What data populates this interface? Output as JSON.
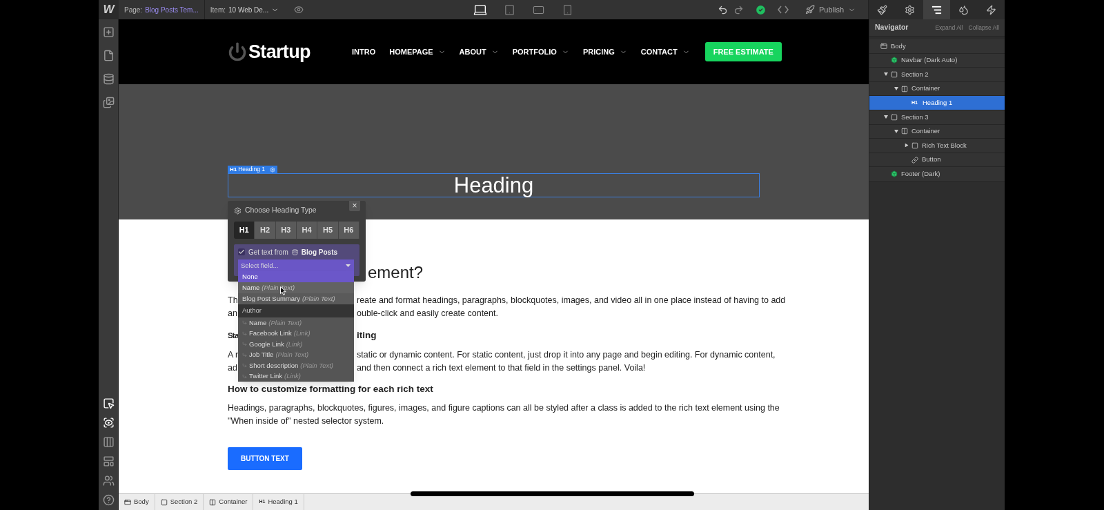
{
  "topbar": {
    "logo": "W",
    "page_label": "Page:",
    "page_name": "Blog Posts Tem...",
    "item_label": "Item:",
    "item_name": "10 Web De...",
    "publish": "Publish",
    "devices": [
      {
        "kind": "desktop",
        "selected": true
      },
      {
        "kind": "tablet",
        "selected": false
      },
      {
        "kind": "landscape",
        "selected": false
      },
      {
        "kind": "phone",
        "selected": false
      }
    ]
  },
  "panel_tabs": [
    {
      "kind": "style",
      "selected": false
    },
    {
      "kind": "settings",
      "selected": false
    },
    {
      "kind": "navigator",
      "selected": true
    },
    {
      "kind": "interactions",
      "selected": false
    },
    {
      "kind": "actions",
      "selected": false
    }
  ],
  "site": {
    "logo": "Startup",
    "cta": "FREE ESTIMATE",
    "nav": [
      {
        "label": "INTRO",
        "dropdown": false
      },
      {
        "label": "HOMEPAGE",
        "dropdown": true
      },
      {
        "label": "ABOUT",
        "dropdown": true
      },
      {
        "label": "PORTFOLIO",
        "dropdown": true
      },
      {
        "label": "PRICING",
        "dropdown": true
      },
      {
        "label": "CONTACT",
        "dropdown": true
      }
    ]
  },
  "hero": {
    "tag_prefix": "H1",
    "tag": "Heading 1",
    "heading": "Heading"
  },
  "heading_popup": {
    "title": "Choose Heading Type",
    "close": "×",
    "levels": [
      {
        "label": "H1",
        "selected": true
      },
      {
        "label": "H2",
        "selected": false
      },
      {
        "label": "H3",
        "selected": false
      },
      {
        "label": "H4",
        "selected": false
      },
      {
        "label": "H5",
        "selected": false
      },
      {
        "label": "H6",
        "selected": false
      }
    ],
    "bind": {
      "checked": true,
      "label": "Get text from",
      "collection": "Blog Posts",
      "placeholder": "Select field..."
    },
    "options": [
      {
        "kind": "option",
        "label": "None",
        "selected": true,
        "hovered": false
      },
      {
        "kind": "option",
        "label": "Name",
        "type": "(Plain Text)",
        "selected": false,
        "hovered": true
      },
      {
        "kind": "option",
        "label": "Blog Post Summary",
        "type": "(Plain Text)",
        "selected": false,
        "hovered": false
      },
      {
        "kind": "group",
        "label": "Author",
        "children": [
          {
            "label": "Name",
            "type": "(Plain Text)"
          },
          {
            "label": "Facebook Link",
            "type": "(Link)"
          },
          {
            "label": "Google Link",
            "type": "(Link)"
          },
          {
            "label": "Job Title",
            "type": "(Plain Text)"
          },
          {
            "label": "Short description",
            "type": "(Plain Text)"
          },
          {
            "label": "Twitter Link",
            "type": "(Link)"
          }
        ]
      }
    ]
  },
  "article": {
    "blocks": [
      {
        "kind": "h2",
        "right": "ement?"
      },
      {
        "kind": "line",
        "left": "Th",
        "right": "reate and format headings, paragraphs, blockquotes, images, and video all in one place instead of having to add"
      },
      {
        "kind": "line",
        "left": "an",
        "right": "ouble-click and easily create content."
      },
      {
        "kind": "h3",
        "left": "Sta",
        "right": "iting"
      },
      {
        "kind": "line",
        "left": "A r",
        "right": "static or dynamic content. For static content, just drop it into any page and begin editing. For dynamic content,"
      },
      {
        "kind": "line",
        "left": "ad",
        "right": "and then connect a rich text element to that field in the settings panel. Voila!"
      },
      {
        "kind": "h3",
        "text": "How to customize formatting for each rich text"
      },
      {
        "kind": "para",
        "text": "Headings, paragraphs, blockquotes, figures, images, and figure captions can all be styled after a class is added to the rich text element using the \"When inside of\" nested selector system."
      }
    ],
    "button": "BUTTON TEXT"
  },
  "navigator": {
    "title": "Navigator",
    "expand_all": "Expand All",
    "collapse_all": "Collapse All",
    "items": [
      {
        "kind": "body",
        "label": "Body",
        "selected": false,
        "children": [
          {
            "kind": "symbol",
            "label": "Navbar (Dark Auto)",
            "selected": false
          },
          {
            "kind": "section",
            "label": "Section 2",
            "selected": false,
            "expanded": true,
            "children": [
              {
                "kind": "container",
                "label": "Container",
                "selected": false,
                "expanded": true,
                "children": [
                  {
                    "kind": "heading",
                    "badge": "H1",
                    "label": "Heading 1",
                    "selected": true
                  }
                ]
              }
            ]
          },
          {
            "kind": "section",
            "label": "Section 3",
            "selected": false,
            "expanded": true,
            "children": [
              {
                "kind": "container",
                "label": "Container",
                "selected": false,
                "expanded": true,
                "children": [
                  {
                    "kind": "section",
                    "label": "Rich Text Block",
                    "selected": false,
                    "expanded": false
                  },
                  {
                    "kind": "link",
                    "label": "Button",
                    "selected": false
                  }
                ]
              }
            ]
          },
          {
            "kind": "symbol",
            "label": "Footer (Dark)",
            "selected": false
          }
        ]
      }
    ]
  },
  "breadcrumb": [
    {
      "kind": "body",
      "label": "Body"
    },
    {
      "kind": "section",
      "label": "Section 2"
    },
    {
      "kind": "container",
      "label": "Container"
    },
    {
      "kind": "heading",
      "badge": "H1",
      "label": "Heading 1"
    }
  ]
}
